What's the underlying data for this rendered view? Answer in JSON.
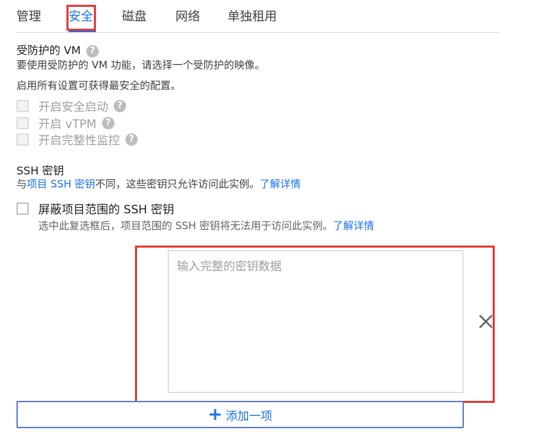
{
  "tabs": [
    {
      "label": "管理"
    },
    {
      "label": "安全"
    },
    {
      "label": "磁盘"
    },
    {
      "label": "网络"
    },
    {
      "label": "单独租用"
    }
  ],
  "shielded_vm": {
    "title": "受防护的 VM",
    "description": "要使用受防护的 VM 功能，请选择一个受防护的映像。",
    "note": "启用所有设置可获得最安全的配置。",
    "options": [
      {
        "label": "开启安全启动"
      },
      {
        "label": "开启 vTPM"
      },
      {
        "label": "开启完整性监控"
      }
    ]
  },
  "ssh": {
    "title": "SSH 密钥",
    "desc_prefix": "与",
    "desc_link": "项目 SSH 密钥",
    "desc_middle": "不同，这些密钥只允许访问此实例。",
    "desc_learn": "了解详情",
    "block_label": "屏蔽项目范围的 SSH 密钥",
    "block_desc": "选中此复选框后，项目范围的 SSH 密钥将无法用于访问此实例。",
    "block_learn": "了解详情",
    "key_placeholder": "输入完整的密钥数据",
    "key_value": "",
    "add_button": "添加一项"
  },
  "colors": {
    "accent": "#1a73e8",
    "highlight": "#e53935"
  }
}
